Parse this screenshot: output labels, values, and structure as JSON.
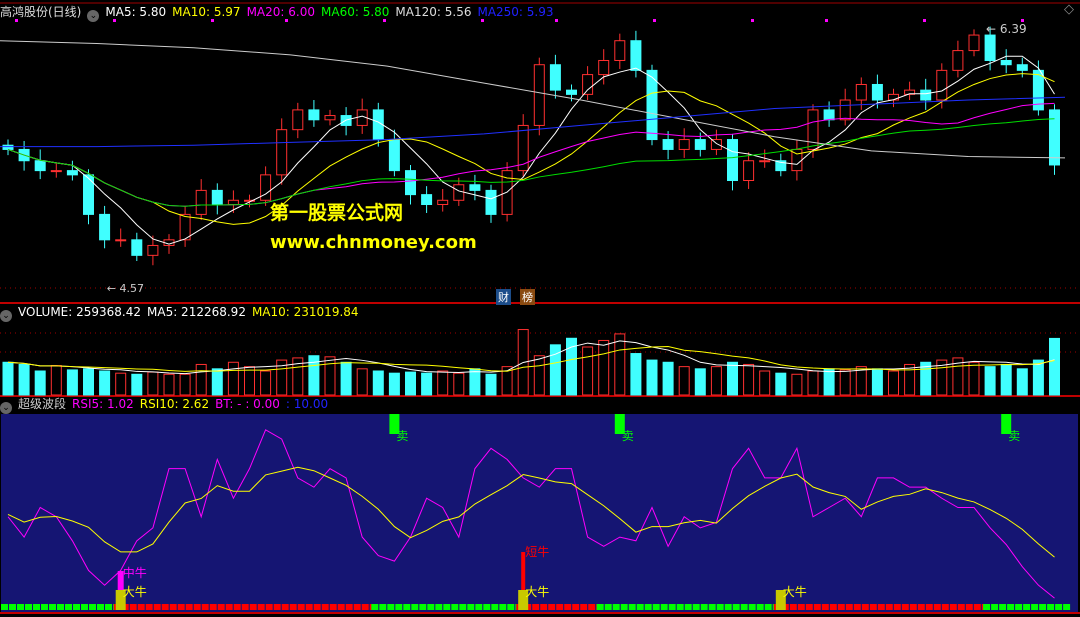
{
  "header": {
    "stock": "高鸿股份(日线)",
    "ma": [
      {
        "label": "MA5: 5.80",
        "color": "#ffffff"
      },
      {
        "label": "MA10: 5.97",
        "color": "#ffff00"
      },
      {
        "label": "MA20: 6.00",
        "color": "#ff00ff"
      },
      {
        "label": "MA60: 5.80",
        "color": "#00ff00"
      },
      {
        "label": "MA120: 5.56",
        "color": "#dddddd"
      },
      {
        "label": "MA250: 5.93",
        "color": "#2020ff"
      }
    ]
  },
  "watermark": {
    "line1": "第一股票公式网",
    "line2": "www.chnmoney.com"
  },
  "tags": {
    "cai": "财",
    "bang": "榜"
  },
  "volume_header": {
    "volume": "VOLUME: 259368.42",
    "ma5": "MA5: 212268.92",
    "ma10": "MA10: 231019.84"
  },
  "indicator_header": {
    "name": "超级波段",
    "rsi5": "RSI5: 1.02",
    "rsi10": "RSI10: 2.62",
    "bt": "BT: - : 0.00",
    "bt2": ": 10.00"
  },
  "chart_data": {
    "type": "candlestick",
    "price_range": [
      4.57,
      6.39
    ],
    "annotations": {
      "high": "6.39",
      "low": "4.57"
    },
    "close": [
      5.53,
      5.45,
      5.38,
      5.38,
      5.35,
      5.07,
      4.89,
      4.89,
      4.78,
      4.85,
      4.89,
      5.07,
      5.24,
      5.14,
      5.17,
      5.17,
      5.35,
      5.67,
      5.81,
      5.74,
      5.77,
      5.7,
      5.81,
      5.6,
      5.38,
      5.21,
      5.14,
      5.17,
      5.28,
      5.24,
      5.07,
      5.38,
      5.7,
      6.13,
      5.95,
      5.92,
      6.06,
      6.16,
      6.3,
      6.09,
      5.6,
      5.53,
      5.6,
      5.53,
      5.6,
      5.31,
      5.45,
      5.45,
      5.38,
      5.53,
      5.81,
      5.74,
      5.88,
      5.99,
      5.88,
      5.92,
      5.95,
      5.88,
      6.09,
      6.23,
      6.34,
      6.16,
      6.13,
      6.09,
      5.81,
      5.42
    ],
    "ma120": [
      6.3,
      6.28,
      6.25,
      6.2,
      6.12,
      6.0,
      5.88,
      5.75,
      5.62,
      5.52,
      5.48,
      5.47
    ],
    "ma250": [
      5.55,
      5.55,
      5.56,
      5.58,
      5.6,
      5.64,
      5.7,
      5.76,
      5.82,
      5.85,
      5.88,
      5.9
    ],
    "volume": [
      150000,
      140000,
      110000,
      135000,
      115000,
      120000,
      110000,
      100000,
      95000,
      105000,
      95000,
      95000,
      140000,
      120000,
      150000,
      130000,
      110000,
      160000,
      170000,
      180000,
      175000,
      150000,
      120000,
      110000,
      100000,
      105000,
      100000,
      110000,
      100000,
      120000,
      95000,
      130000,
      300000,
      180000,
      230000,
      260000,
      220000,
      250000,
      280000,
      190000,
      160000,
      150000,
      130000,
      120000,
      130000,
      150000,
      140000,
      110000,
      100000,
      95000,
      110000,
      120000,
      115000,
      130000,
      120000,
      110000,
      140000,
      150000,
      160000,
      170000,
      150000,
      130000,
      140000,
      120000,
      160000,
      259368
    ],
    "rsi5": [
      45,
      34,
      50,
      45,
      32,
      16,
      8,
      16,
      32,
      39,
      71,
      71,
      45,
      76,
      55,
      71,
      92,
      87,
      66,
      61,
      71,
      66,
      34,
      24,
      21,
      34,
      55,
      50,
      34,
      71,
      82,
      76,
      66,
      61,
      71,
      71,
      34,
      29,
      34,
      32,
      50,
      29,
      45,
      39,
      42,
      71,
      82,
      66,
      66,
      82,
      45,
      50,
      55,
      45,
      66,
      66,
      61,
      61,
      55,
      50,
      50,
      39,
      30,
      18,
      8,
      1.02
    ],
    "rsi_range": [
      0,
      100
    ],
    "signals": [
      {
        "index": 7,
        "label": "中牛",
        "color": "#ff00ff"
      },
      {
        "index": 7,
        "label": "大牛",
        "color": "#ffff00"
      },
      {
        "index": 32,
        "label": "短牛",
        "color": "#ff0000"
      },
      {
        "index": 32,
        "label": "大牛",
        "color": "#ffff00"
      },
      {
        "index": 48,
        "label": "大牛",
        "color": "#ffff00"
      },
      {
        "index": 24,
        "label": "卖",
        "color": "#00ff00"
      },
      {
        "index": 38,
        "label": "卖",
        "color": "#00ff00"
      },
      {
        "index": 62,
        "label": "卖",
        "color": "#00ff00"
      }
    ],
    "trend": [
      [
        "green",
        0,
        7
      ],
      [
        "red",
        7,
        23
      ],
      [
        "green",
        23,
        32
      ],
      [
        "red",
        32,
        37
      ],
      [
        "green",
        37,
        48
      ],
      [
        "red",
        48,
        61
      ],
      [
        "green",
        61,
        66
      ]
    ]
  }
}
